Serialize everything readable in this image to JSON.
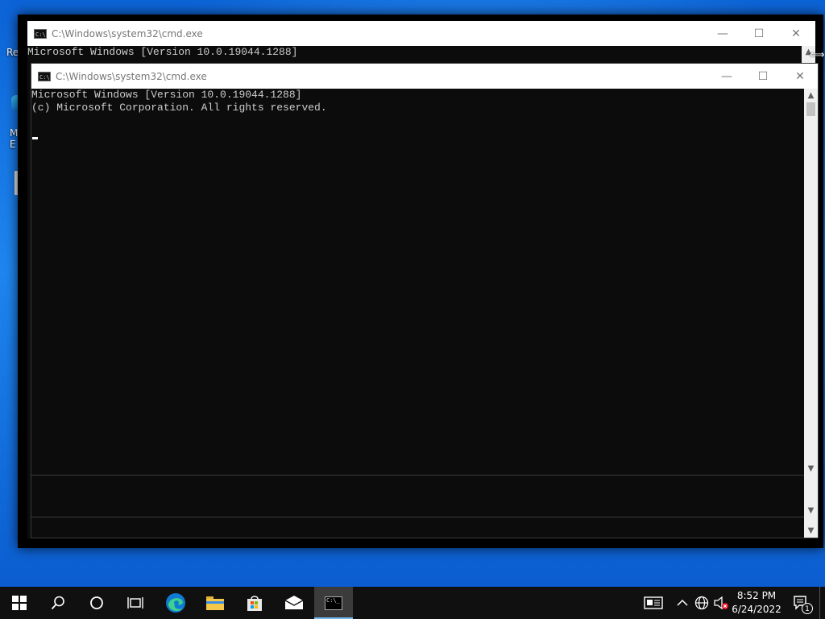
{
  "desktop": {
    "icon_labels": [
      "Re",
      "M",
      "E"
    ]
  },
  "back_window": {
    "title": "C:\\Windows\\system32\\cmd.exe",
    "line1": "Microsoft Windows [Version 10.0.19044.1288]"
  },
  "front_window": {
    "title": "C:\\Windows\\system32\\cmd.exe",
    "line1": "Microsoft Windows [Version 10.0.19044.1288]",
    "line2": "(c) Microsoft Corporation. All rights reserved."
  },
  "window_buttons": {
    "minimize": "—",
    "maximize": "☐",
    "close": "✕"
  },
  "taskbar": {
    "clock_time": "8:52 PM",
    "clock_date": "6/24/2022",
    "notification_count": "1",
    "cmd_icon_text": "C:\\_"
  },
  "colors": {
    "console_bg": "#0c0c0c",
    "console_text": "#cccccc",
    "taskbar_bg": "#101010",
    "accent": "#0078d7"
  }
}
